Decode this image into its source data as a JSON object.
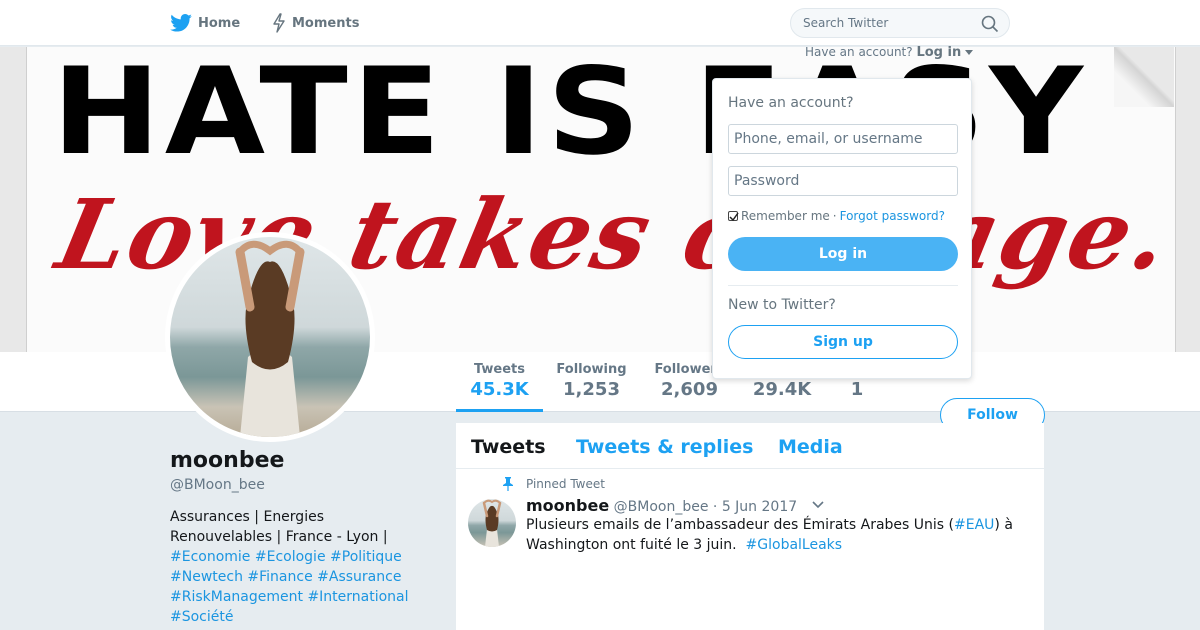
{
  "nav": {
    "home_label": "Home",
    "moments_label": "Moments",
    "search_placeholder": "Search Twitter",
    "account_prompt": "Have an account?",
    "login_label": "Log in"
  },
  "banner": {
    "headline": "HATE IS EASY",
    "script": "Love takes courage."
  },
  "profile": {
    "display_name": "moonbee",
    "screen_name": "@BMoon_bee",
    "bio_text": "Assurances | Energies Renouvelables | France - Lyon |",
    "hashtags": [
      "#Economie",
      "#Ecologie",
      "#Politique",
      "#Newtech",
      "#Finance",
      "#Assurance",
      "#RiskManagement",
      "#International",
      "#Société"
    ]
  },
  "stats": [
    {
      "label": "Tweets",
      "value": "45.3K"
    },
    {
      "label": "Following",
      "value": "1,253"
    },
    {
      "label": "Followers",
      "value": "2,609"
    },
    {
      "label": "",
      "value": "29.4K"
    },
    {
      "label": "",
      "value": "1"
    }
  ],
  "follow_label": "Follow",
  "tabs": [
    "Tweets",
    "Tweets & replies",
    "Media"
  ],
  "tweet": {
    "pinned_label": "Pinned Tweet",
    "name": "moonbee",
    "handle": "@BMoon_bee",
    "date": "· 5 Jun 2017",
    "text_before": "Plusieurs emails de l’ambassadeur des Émirats Arabes Unis (",
    "hashtag1": "#EAU",
    "text_middle": ") à Washington ont fuité le 3 juin.",
    "hashtag2": "#GlobalLeaks"
  },
  "login_dropdown": {
    "heading": "Have an account?",
    "username_placeholder": "Phone, email, or username",
    "password_placeholder": "Password",
    "remember_label": "Remember me",
    "separator": "·",
    "forgot_label": "Forgot password?",
    "login_button": "Log in",
    "new_heading": "New to Twitter?",
    "signup_button": "Sign up"
  },
  "colors": {
    "accent": "#1da1f2",
    "link": "#1b95e0",
    "background": "#e6ecf0"
  }
}
